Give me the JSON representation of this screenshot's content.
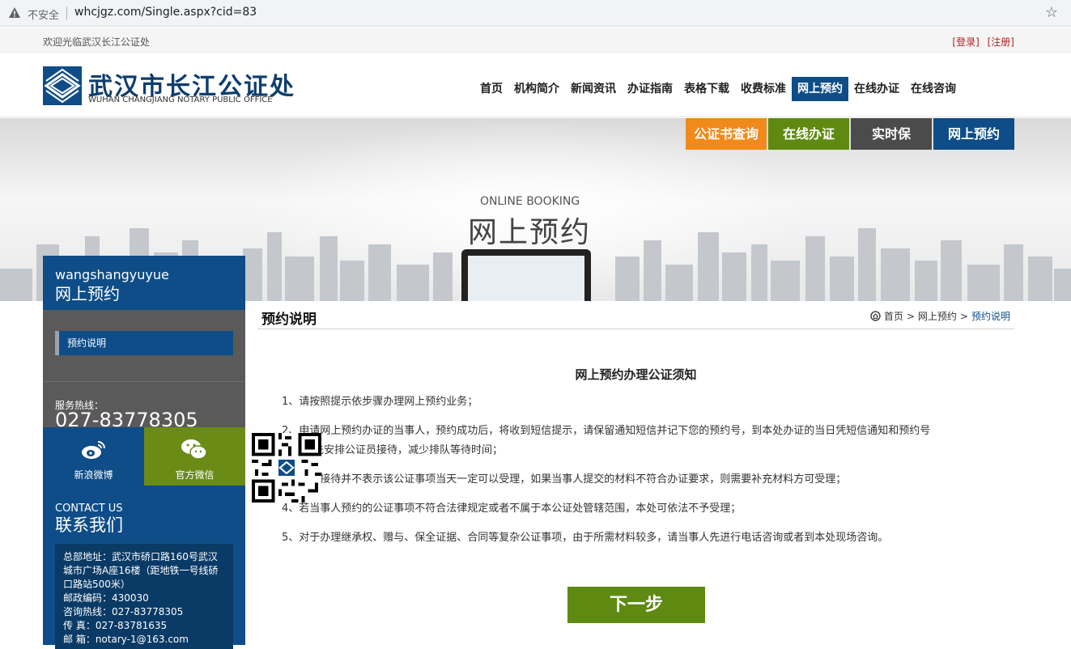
{
  "browser": {
    "insecure_label": "不安全",
    "url": "whcjgz.com/Single.aspx?cid=83"
  },
  "topbar": {
    "welcome": "欢迎光临武汉长江公证处",
    "login": "[登录]",
    "register": "[注册]"
  },
  "logo": {
    "name_cn": "武汉市长江公证处",
    "name_en": "WUHAN CHANGJIANG NOTARY PUBLIC OFFICE"
  },
  "nav": [
    {
      "label": "首页"
    },
    {
      "label": "机构简介"
    },
    {
      "label": "新闻资讯"
    },
    {
      "label": "办证指南"
    },
    {
      "label": "表格下载"
    },
    {
      "label": "收费标准"
    },
    {
      "label": "网上预约",
      "active": true
    },
    {
      "label": "在线办证"
    },
    {
      "label": "在线咨询"
    }
  ],
  "quick_links": [
    {
      "label": "公证书查询",
      "color": "#f28a1b"
    },
    {
      "label": "在线办证",
      "color": "#5e8a12"
    },
    {
      "label": "实时保",
      "color": "#4b4b4b"
    },
    {
      "label": "网上预约",
      "color": "#0e4d87"
    }
  ],
  "banner": {
    "en": "ONLINE BOOKING",
    "cn": "网上预约"
  },
  "sidebar": {
    "pinyin": "wangshangyuyue",
    "title": "网上预约",
    "menu_item": "预约说明",
    "hotline_label": "服务热线：",
    "hotline": "027-83778305",
    "weibo": "新浪微博",
    "weixin": "官方微信",
    "contact_en": "CONTACT US",
    "contact_cn": "联系我们",
    "contact_lines": [
      "总部地址：武汉市硚口路160号武汉",
      "城市广场A座16楼（距地铁一号线硚",
      "口路站500米）",
      "邮政编码：430030",
      "咨询热线：027-83778305",
      "传 真：027-83781635",
      "邮 箱：notary-1@163.com"
    ]
  },
  "content": {
    "section_title": "预约说明",
    "breadcrumb": [
      "首页",
      ">",
      "网上预约",
      ">",
      "预约说明"
    ],
    "notice_title": "网上预约办理公证须知",
    "paragraphs": [
      "1、请按照提示依步骤办理网上预约业务；",
      "2、申请网上预约办证的当事人，预约成功后，将收到短信提示，请保留通知短信并记下您的预约号，到本处办证的当日凭短信通知和预约号",
      "本处优先安排公证员接待，减少排队等待时间；",
      "3、预约接待并不表示该公证事项当天一定可以受理，如果当事人提交的材料不符合办证要求，则需要补充材料方可受理；",
      "4、若当事人预约的公证事项不符合法律规定或者不属于本公证处管辖范围，本处可依法不予受理；",
      "5、对于办理继承权、赠与、保全证据、合同等复杂公证事项，由于所需材料较多，请当事人先进行电话咨询或者到本处现场咨询。"
    ],
    "next_button": "下一步"
  }
}
